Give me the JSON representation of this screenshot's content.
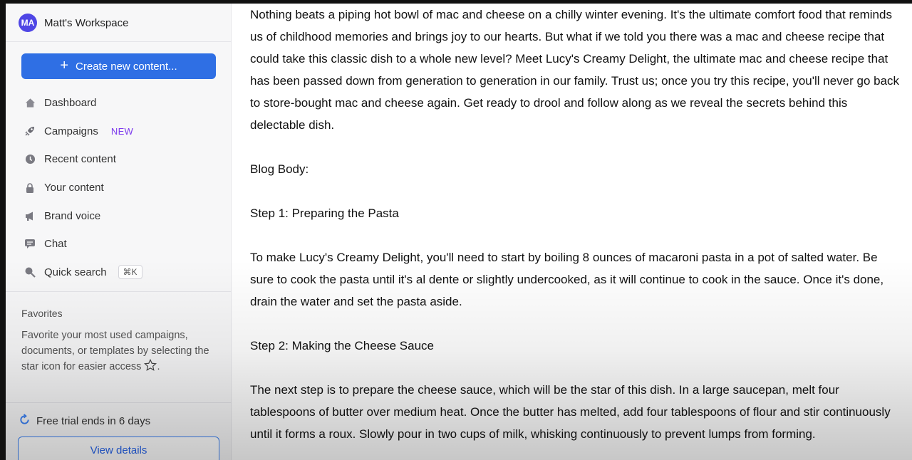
{
  "workspace": {
    "avatar_initials": "MA",
    "name": "Matt's Workspace"
  },
  "create_button": {
    "label": "Create new content..."
  },
  "nav": {
    "items": [
      {
        "label": "Dashboard",
        "icon": "home-icon"
      },
      {
        "label": "Campaigns",
        "icon": "rocket-icon",
        "badge": "NEW"
      },
      {
        "label": "Recent content",
        "icon": "clock-icon"
      },
      {
        "label": "Your content",
        "icon": "lock-icon"
      },
      {
        "label": "Brand voice",
        "icon": "megaphone-icon"
      },
      {
        "label": "Chat",
        "icon": "chat-icon"
      },
      {
        "label": "Quick search",
        "icon": "search-icon",
        "shortcut": "⌘K"
      }
    ]
  },
  "favorites": {
    "title": "Favorites",
    "description": "Favorite your most used campaigns, documents, or templates by selecting the star icon for easier access"
  },
  "trial": {
    "text": "Free trial ends in 6 days",
    "button_label": "View details"
  },
  "content": {
    "paragraphs": [
      "Nothing beats a piping hot bowl of mac and cheese on a chilly winter evening. It's the ultimate comfort food that reminds us of childhood memories and brings joy to our hearts. But what if we told you there was a mac and cheese recipe that could take this classic dish to a whole new level? Meet Lucy's Creamy Delight, the ultimate mac and cheese recipe that has been passed down from generation to generation in our family. Trust us; once you try this recipe, you'll never go back to store-bought mac and cheese again. Get ready to drool and follow along as we reveal the secrets behind this delectable dish.",
      "Blog Body:",
      "Step 1: Preparing the Pasta",
      "To make Lucy's Creamy Delight, you'll need to start by boiling 8 ounces of macaroni pasta in a pot of salted water. Be sure to cook the pasta until it's al dente or slightly undercooked, as it will continue to cook in the sauce. Once it's done, drain the water and set the pasta aside.",
      "Step 2: Making the Cheese Sauce",
      "The next step is to prepare the cheese sauce, which will be the star of this dish. In a large saucepan, melt four tablespoons of butter over medium heat. Once the butter has melted, add four tablespoons of flour and stir continuously until it forms a roux. Slowly pour in two cups of milk, whisking continuously to prevent lumps from forming."
    ]
  },
  "colors": {
    "accent": "#2f6fe4",
    "avatar": "#4f46e5",
    "new_badge": "#7c3aed"
  }
}
